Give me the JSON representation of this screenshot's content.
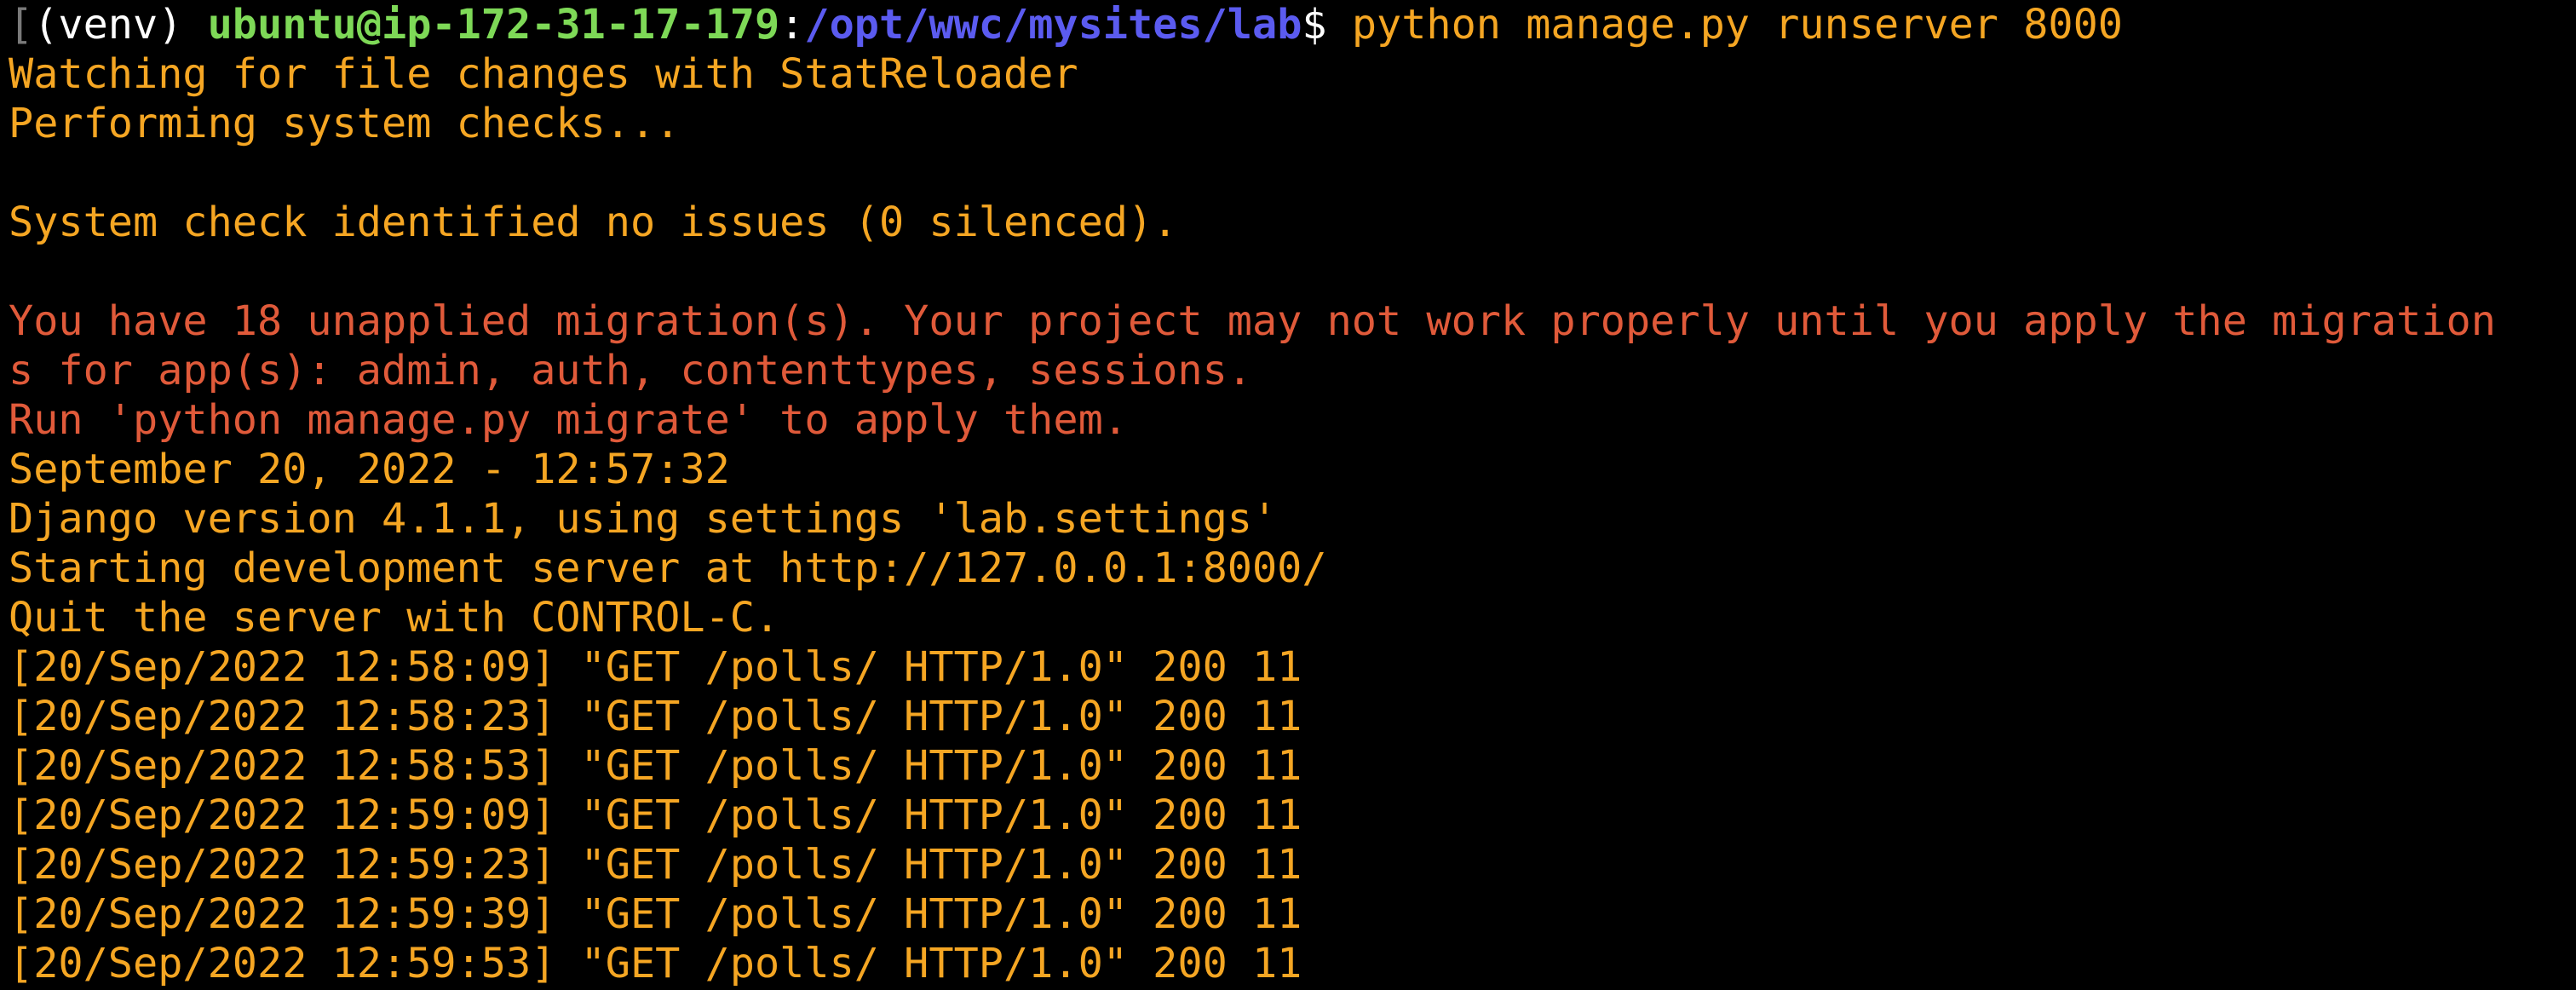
{
  "colors": {
    "background": "#000000",
    "output": "#f5a623",
    "warning": "#e05a3a",
    "prompt_user": "#7ed957",
    "prompt_path": "#5b5bf0",
    "prompt_plain": "#ffffff"
  },
  "prompt": {
    "cursor_mark": "[",
    "env": "(venv) ",
    "user_host": "ubuntu@ip-172-31-17-179",
    "colon": ":",
    "path": "/opt/wwc/mysites/lab",
    "symbol": "$ ",
    "command": "python manage.py runserver 8000"
  },
  "output_lines": {
    "watching": "Watching for file changes with StatReloader",
    "performing": "Performing system checks...",
    "system_check": "System check identified no issues (0 silenced).",
    "warning_1": "You have 18 unapplied migration(s). Your project may not work properly until you apply the migration",
    "warning_2": "s for app(s): admin, auth, contenttypes, sessions.",
    "warning_3": "Run 'python manage.py migrate' to apply them.",
    "timestamp": "September 20, 2022 - 12:57:32",
    "django_version": "Django version 4.1.1, using settings 'lab.settings'",
    "starting_server": "Starting development server at http://127.0.0.1:8000/",
    "quit_hint": "Quit the server with CONTROL-C."
  },
  "log_lines": [
    "[20/Sep/2022 12:58:09] \"GET /polls/ HTTP/1.0\" 200 11",
    "[20/Sep/2022 12:58:23] \"GET /polls/ HTTP/1.0\" 200 11",
    "[20/Sep/2022 12:58:53] \"GET /polls/ HTTP/1.0\" 200 11",
    "[20/Sep/2022 12:59:09] \"GET /polls/ HTTP/1.0\" 200 11",
    "[20/Sep/2022 12:59:23] \"GET /polls/ HTTP/1.0\" 200 11",
    "[20/Sep/2022 12:59:39] \"GET /polls/ HTTP/1.0\" 200 11",
    "[20/Sep/2022 12:59:53] \"GET /polls/ HTTP/1.0\" 200 11"
  ]
}
